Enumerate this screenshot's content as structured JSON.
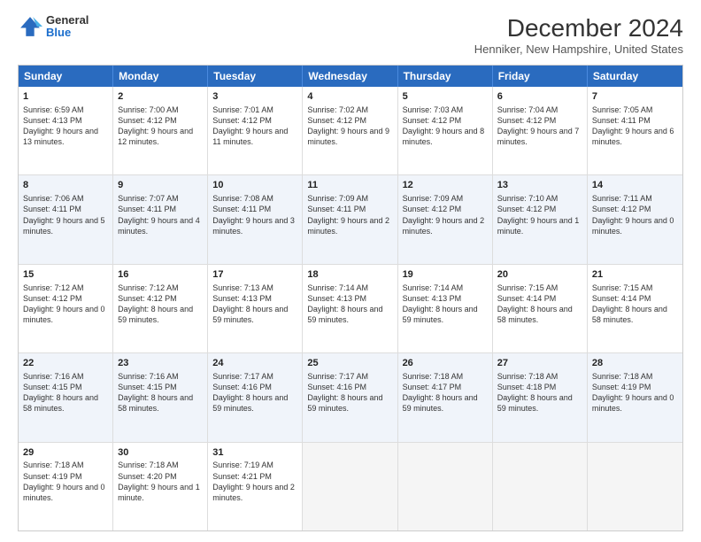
{
  "logo": {
    "general": "General",
    "blue": "Blue"
  },
  "title": "December 2024",
  "location": "Henniker, New Hampshire, United States",
  "days_of_week": [
    "Sunday",
    "Monday",
    "Tuesday",
    "Wednesday",
    "Thursday",
    "Friday",
    "Saturday"
  ],
  "weeks": [
    [
      {
        "day": "1",
        "sunrise": "Sunrise: 6:59 AM",
        "sunset": "Sunset: 4:13 PM",
        "daylight": "Daylight: 9 hours and 13 minutes."
      },
      {
        "day": "2",
        "sunrise": "Sunrise: 7:00 AM",
        "sunset": "Sunset: 4:12 PM",
        "daylight": "Daylight: 9 hours and 12 minutes."
      },
      {
        "day": "3",
        "sunrise": "Sunrise: 7:01 AM",
        "sunset": "Sunset: 4:12 PM",
        "daylight": "Daylight: 9 hours and 11 minutes."
      },
      {
        "day": "4",
        "sunrise": "Sunrise: 7:02 AM",
        "sunset": "Sunset: 4:12 PM",
        "daylight": "Daylight: 9 hours and 9 minutes."
      },
      {
        "day": "5",
        "sunrise": "Sunrise: 7:03 AM",
        "sunset": "Sunset: 4:12 PM",
        "daylight": "Daylight: 9 hours and 8 minutes."
      },
      {
        "day": "6",
        "sunrise": "Sunrise: 7:04 AM",
        "sunset": "Sunset: 4:12 PM",
        "daylight": "Daylight: 9 hours and 7 minutes."
      },
      {
        "day": "7",
        "sunrise": "Sunrise: 7:05 AM",
        "sunset": "Sunset: 4:11 PM",
        "daylight": "Daylight: 9 hours and 6 minutes."
      }
    ],
    [
      {
        "day": "8",
        "sunrise": "Sunrise: 7:06 AM",
        "sunset": "Sunset: 4:11 PM",
        "daylight": "Daylight: 9 hours and 5 minutes."
      },
      {
        "day": "9",
        "sunrise": "Sunrise: 7:07 AM",
        "sunset": "Sunset: 4:11 PM",
        "daylight": "Daylight: 9 hours and 4 minutes."
      },
      {
        "day": "10",
        "sunrise": "Sunrise: 7:08 AM",
        "sunset": "Sunset: 4:11 PM",
        "daylight": "Daylight: 9 hours and 3 minutes."
      },
      {
        "day": "11",
        "sunrise": "Sunrise: 7:09 AM",
        "sunset": "Sunset: 4:11 PM",
        "daylight": "Daylight: 9 hours and 2 minutes."
      },
      {
        "day": "12",
        "sunrise": "Sunrise: 7:09 AM",
        "sunset": "Sunset: 4:12 PM",
        "daylight": "Daylight: 9 hours and 2 minutes."
      },
      {
        "day": "13",
        "sunrise": "Sunrise: 7:10 AM",
        "sunset": "Sunset: 4:12 PM",
        "daylight": "Daylight: 9 hours and 1 minute."
      },
      {
        "day": "14",
        "sunrise": "Sunrise: 7:11 AM",
        "sunset": "Sunset: 4:12 PM",
        "daylight": "Daylight: 9 hours and 0 minutes."
      }
    ],
    [
      {
        "day": "15",
        "sunrise": "Sunrise: 7:12 AM",
        "sunset": "Sunset: 4:12 PM",
        "daylight": "Daylight: 9 hours and 0 minutes."
      },
      {
        "day": "16",
        "sunrise": "Sunrise: 7:12 AM",
        "sunset": "Sunset: 4:12 PM",
        "daylight": "Daylight: 8 hours and 59 minutes."
      },
      {
        "day": "17",
        "sunrise": "Sunrise: 7:13 AM",
        "sunset": "Sunset: 4:13 PM",
        "daylight": "Daylight: 8 hours and 59 minutes."
      },
      {
        "day": "18",
        "sunrise": "Sunrise: 7:14 AM",
        "sunset": "Sunset: 4:13 PM",
        "daylight": "Daylight: 8 hours and 59 minutes."
      },
      {
        "day": "19",
        "sunrise": "Sunrise: 7:14 AM",
        "sunset": "Sunset: 4:13 PM",
        "daylight": "Daylight: 8 hours and 59 minutes."
      },
      {
        "day": "20",
        "sunrise": "Sunrise: 7:15 AM",
        "sunset": "Sunset: 4:14 PM",
        "daylight": "Daylight: 8 hours and 58 minutes."
      },
      {
        "day": "21",
        "sunrise": "Sunrise: 7:15 AM",
        "sunset": "Sunset: 4:14 PM",
        "daylight": "Daylight: 8 hours and 58 minutes."
      }
    ],
    [
      {
        "day": "22",
        "sunrise": "Sunrise: 7:16 AM",
        "sunset": "Sunset: 4:15 PM",
        "daylight": "Daylight: 8 hours and 58 minutes."
      },
      {
        "day": "23",
        "sunrise": "Sunrise: 7:16 AM",
        "sunset": "Sunset: 4:15 PM",
        "daylight": "Daylight: 8 hours and 58 minutes."
      },
      {
        "day": "24",
        "sunrise": "Sunrise: 7:17 AM",
        "sunset": "Sunset: 4:16 PM",
        "daylight": "Daylight: 8 hours and 59 minutes."
      },
      {
        "day": "25",
        "sunrise": "Sunrise: 7:17 AM",
        "sunset": "Sunset: 4:16 PM",
        "daylight": "Daylight: 8 hours and 59 minutes."
      },
      {
        "day": "26",
        "sunrise": "Sunrise: 7:18 AM",
        "sunset": "Sunset: 4:17 PM",
        "daylight": "Daylight: 8 hours and 59 minutes."
      },
      {
        "day": "27",
        "sunrise": "Sunrise: 7:18 AM",
        "sunset": "Sunset: 4:18 PM",
        "daylight": "Daylight: 8 hours and 59 minutes."
      },
      {
        "day": "28",
        "sunrise": "Sunrise: 7:18 AM",
        "sunset": "Sunset: 4:19 PM",
        "daylight": "Daylight: 9 hours and 0 minutes."
      }
    ],
    [
      {
        "day": "29",
        "sunrise": "Sunrise: 7:18 AM",
        "sunset": "Sunset: 4:19 PM",
        "daylight": "Daylight: 9 hours and 0 minutes."
      },
      {
        "day": "30",
        "sunrise": "Sunrise: 7:18 AM",
        "sunset": "Sunset: 4:20 PM",
        "daylight": "Daylight: 9 hours and 1 minute."
      },
      {
        "day": "31",
        "sunrise": "Sunrise: 7:19 AM",
        "sunset": "Sunset: 4:21 PM",
        "daylight": "Daylight: 9 hours and 2 minutes."
      },
      null,
      null,
      null,
      null
    ]
  ]
}
